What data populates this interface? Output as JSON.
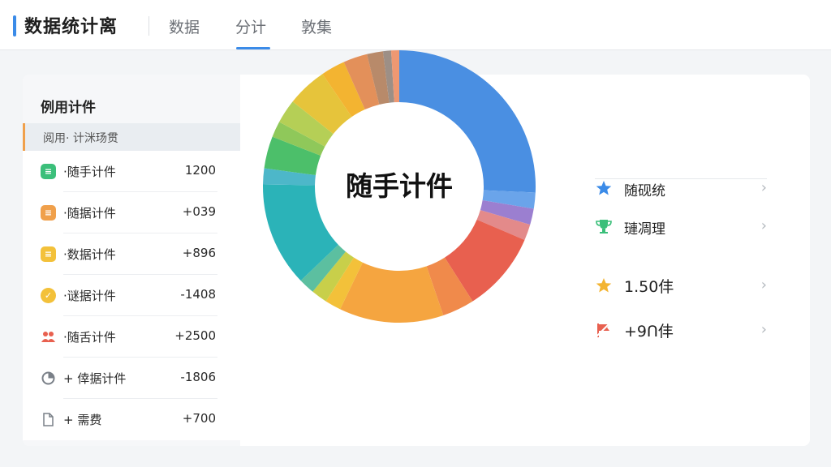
{
  "header": {
    "title": "数据统计离",
    "tabs": [
      {
        "label": "数据",
        "active": false
      },
      {
        "label": "分计",
        "active": true
      },
      {
        "label": "敦集",
        "active": false
      }
    ],
    "accent_color": "#3b8be8"
  },
  "left_panel": {
    "title": "例用计件",
    "filter_label": "阅用· 计洣玚贯",
    "items": [
      {
        "label": "·随手计件",
        "value": "1200",
        "icon": "list-icon",
        "color": "#3bbf7a"
      },
      {
        "label": "·随据计件",
        "value": "+039",
        "icon": "list-icon",
        "color": "#f0a04b"
      },
      {
        "label": "·数据计件",
        "value": "+896",
        "icon": "list-icon",
        "color": "#f3c13a"
      },
      {
        "label": "·谜据计件",
        "value": "-1408",
        "icon": "check-icon",
        "color": "#f3c13a"
      },
      {
        "label": "·随舌计件",
        "value": "+2500",
        "icon": "people-icon",
        "color": "#e8604f"
      },
      {
        "label": "+ 倖据计件",
        "value": "-1806",
        "icon": "pie-icon",
        "color": "#7a8088"
      },
      {
        "label": "+ 需费",
        "value": "+700",
        "icon": "document-icon",
        "color": "#7a8088"
      }
    ]
  },
  "donut": {
    "center_label": "随手计件"
  },
  "legend": {
    "items": [
      {
        "label": "随砚统",
        "icon": "star-icon",
        "color": "#3b8be8"
      },
      {
        "label": "璉凋理",
        "icon": "trophy-icon",
        "color": "#3bbf7a"
      },
      {
        "label": "1.50仹",
        "icon": "star-icon",
        "color": "#f3b431"
      },
      {
        "label": "+9Ո仹",
        "icon": "flag-icon",
        "color": "#e8604f"
      }
    ]
  },
  "chart_data": {
    "type": "pie",
    "slices": [
      {
        "value": 27,
        "color": "#4a8fe2"
      },
      {
        "value": 2,
        "color": "#6aa4ea"
      },
      {
        "value": 2,
        "color": "#9b7fd0"
      },
      {
        "value": 2,
        "color": "#e38a8a"
      },
      {
        "value": 10,
        "color": "#e8604f"
      },
      {
        "value": 4,
        "color": "#f08a4b"
      },
      {
        "value": 13,
        "color": "#f5a540"
      },
      {
        "value": 2,
        "color": "#f3c13a"
      },
      {
        "value": 2,
        "color": "#c8cf4a"
      },
      {
        "value": 2,
        "color": "#5cbfa0"
      },
      {
        "value": 13,
        "color": "#2bb3b8"
      },
      {
        "value": 2,
        "color": "#4db7c9"
      },
      {
        "value": 4,
        "color": "#4cbf6a"
      },
      {
        "value": 2,
        "color": "#8fc85a"
      },
      {
        "value": 3,
        "color": "#b5cf56"
      },
      {
        "value": 5,
        "color": "#e6c43b"
      },
      {
        "value": 3,
        "color": "#f3b431"
      },
      {
        "value": 3,
        "color": "#e3905a"
      },
      {
        "value": 2,
        "color": "#b88a6a"
      },
      {
        "value": 1,
        "color": "#9d8f86"
      },
      {
        "value": 1,
        "color": "#ee9872"
      }
    ]
  }
}
